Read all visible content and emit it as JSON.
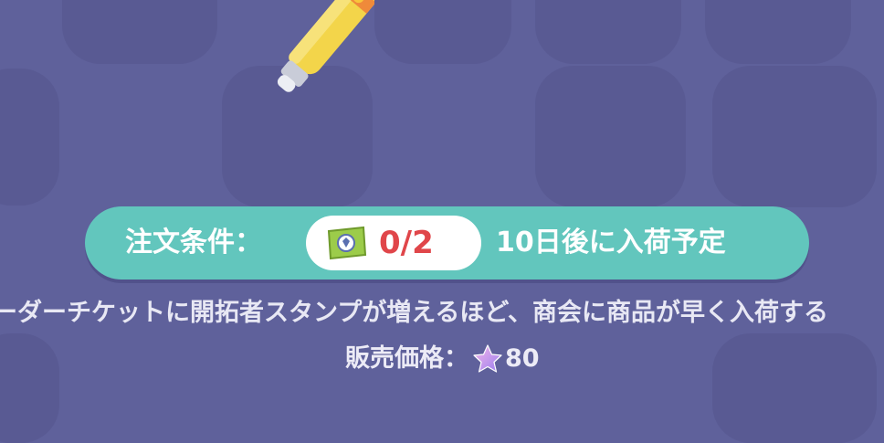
{
  "order_condition": {
    "label": "注文条件：",
    "ticket_count": "0/2",
    "arrival": "10日後に入荷予定"
  },
  "description": "ーダーチケットに開拓者スタンプが増えるほど、商会に商品が早く入荷する",
  "price": {
    "label": "販売価格：",
    "value": "80"
  },
  "colors": {
    "background": "#5f619b",
    "condition_bar": "#62c6bd",
    "ticket_count": "#e0464a"
  },
  "icons": [
    "pencil-icon",
    "stamp-ticket-icon",
    "star-currency-icon"
  ]
}
